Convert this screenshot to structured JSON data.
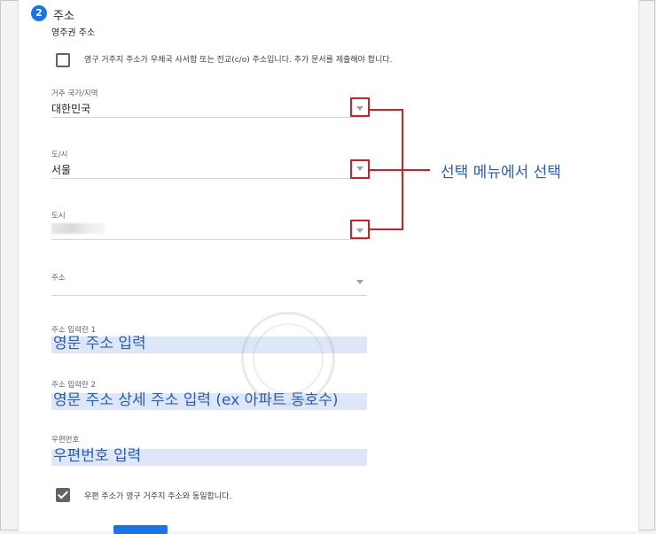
{
  "section": {
    "step_number": "2",
    "title": "주소",
    "subtitle": "영주권 주소"
  },
  "care_of_checkbox": {
    "label": "영구 거주지 주소가 우체국 사서함 또는 전교(c/o) 주소입니다. 추가 문서를 제출해야 합니다.",
    "checked": false
  },
  "fields": {
    "country": {
      "label": "거주 국가/지역",
      "value": "대한민국"
    },
    "province": {
      "label": "도/시",
      "value": "서울"
    },
    "city": {
      "label": "도시",
      "value": ""
    },
    "address": {
      "label": "주소",
      "value": ""
    },
    "address_line_1": {
      "label": "주소 입력란 1",
      "value": "영문 주소 입력"
    },
    "address_line_2": {
      "label": "주소 입력란 2",
      "value": "영문 주소 상세 주소 입력 (ex 아파트 동호수)"
    },
    "postal_code": {
      "label": "우편번호",
      "value": "우편번호 입력"
    }
  },
  "same_address_checkbox": {
    "label": "우편 주소가 영구 거주지 주소와 동일합니다.",
    "checked": true
  },
  "annotation": {
    "text": "선택 메뉴에서 선택",
    "color": "#d32027"
  },
  "colors": {
    "accent": "#1a73e8",
    "highlight": "#dde7f8",
    "annotation_text": "#2a5db0"
  }
}
